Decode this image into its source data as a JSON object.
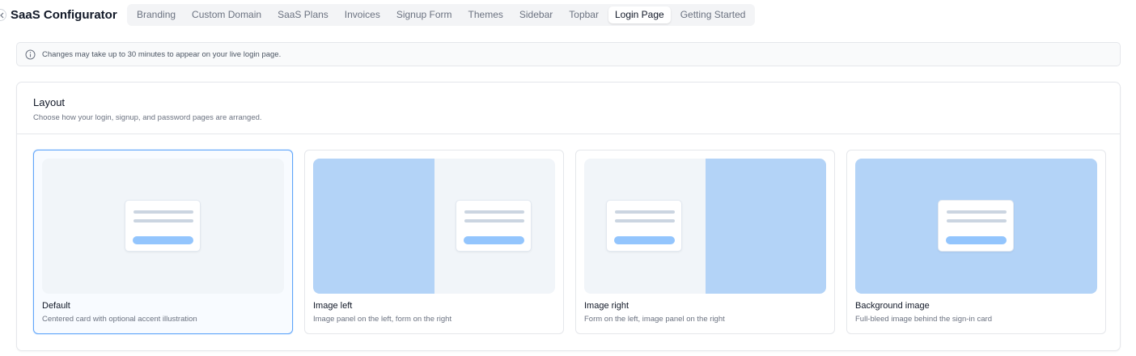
{
  "app": {
    "title": "SaaS Configurator"
  },
  "tabs": [
    {
      "label": "Branding"
    },
    {
      "label": "Custom Domain"
    },
    {
      "label": "SaaS Plans"
    },
    {
      "label": "Invoices"
    },
    {
      "label": "Signup Form"
    },
    {
      "label": "Themes"
    },
    {
      "label": "Sidebar"
    },
    {
      "label": "Topbar"
    },
    {
      "label": "Login Page",
      "active": true
    },
    {
      "label": "Getting Started"
    }
  ],
  "notice": {
    "icon": "info-icon",
    "text": "Changes may take up to 30 minutes to appear on your live login page."
  },
  "layout": {
    "title": "Layout",
    "subtitle": "Choose how your login, signup, and password pages are arranged.",
    "selected": "Default",
    "options": [
      {
        "title": "Default",
        "description": "Centered card with optional accent illustration"
      },
      {
        "title": "Image left",
        "description": "Image panel on the left, form on the right"
      },
      {
        "title": "Image right",
        "description": "Form on the left, image panel on the right"
      },
      {
        "title": "Background image",
        "description": "Full-bleed image behind the sign-in card"
      }
    ]
  },
  "colors": {
    "accent": "#60a5fa",
    "image_panel": "#b3d3f7",
    "preview_bg": "#f1f5f9",
    "button_placeholder": "#93c5fd"
  }
}
